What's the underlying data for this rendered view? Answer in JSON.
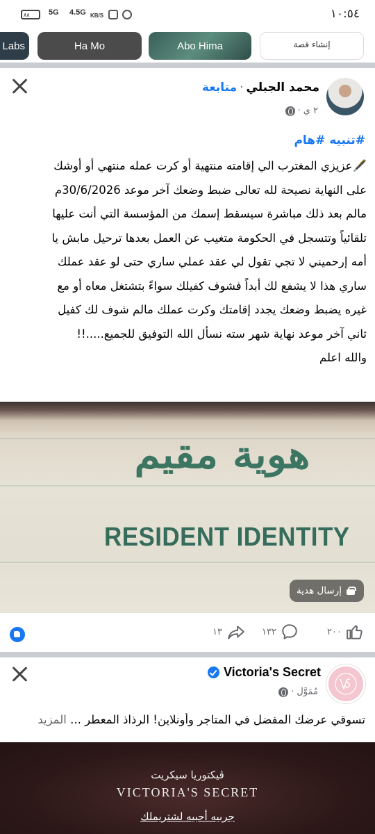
{
  "status_bar": {
    "time": "١٠:٥٤",
    "network_1": "5G",
    "network_2": "4.5G",
    "speed": "KB/S",
    "battery": "٨٨"
  },
  "stories": [
    {
      "label": "Labs"
    },
    {
      "label": "Ha Mo"
    },
    {
      "label": "Abo Hima"
    },
    {
      "label": "إنشاء قصة"
    }
  ],
  "post": {
    "author": "محمد الجبلي",
    "follow": "متابعة",
    "time": "٢ ي",
    "hashtags": "#تنبيه #هام",
    "lines": [
      "🖋️عزيزي المغترب الي إقامته منتهية أو كرت عمله منتهي أو أوشك",
      "على النهاية نصيحة لله تعالى ضبط وضعك آخر موعد 30/6/2026م",
      "مالم بعد ذلك مباشرة سيسقط إسمك من المؤسسة التي أنت عليها",
      "تلقائياً وتتسجل في الحكومة متغيب عن العمل بعدها ترحيل مابش يا",
      "أمه إرحميني لا تجي تقول لي عقد عملي ساري حتى لو عقد عملك",
      "ساري هذا لا يشفع لك أبداً فشوف كفيلك سواءً بتشتغل معاه أو مع",
      "غيره يضبط وضعك يجدد إقامتك وكرت عملك مالم شوف لك كفيل",
      "ثاني آخر موعد نهاية شهر سته نسأل الله التوفيق للجميع.....!!",
      "والله اعلم"
    ],
    "image": {
      "arabic_text": "هوية مقيم",
      "english_text": "RESIDENT IDENTITY"
    },
    "gift_button": "إرسال هدية",
    "reactions_count": "٢٠٠",
    "comments_count": "١٣٢",
    "shares_count": "١٣"
  },
  "ad": {
    "brand": "Victoria's Secret",
    "sponsored": "مُمَوَّل",
    "text": "تسوقي عرضك المفضل في المتاجر وأونلاين! الرذاذ المعطر ... ",
    "more": "المزيد",
    "banner_arabic": "ڤيكتوريا سيكريت",
    "banner_english": "VICTORIA'S SECRET",
    "banner_bottom": "جربيه أحبيه لشتريملك"
  },
  "colors": {
    "accent": "#1877f2",
    "muted": "#65676b",
    "separator": "#c9ccd1"
  }
}
